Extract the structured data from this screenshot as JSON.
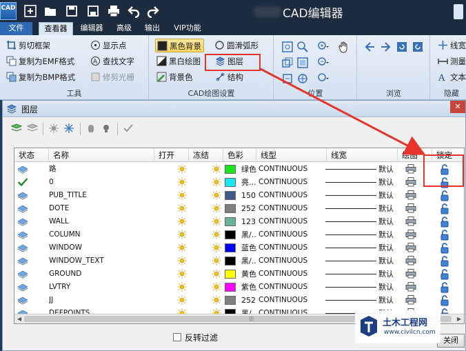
{
  "app": {
    "logo_text": "CAD",
    "title": "CAD编辑器"
  },
  "ribbon_tabs": [
    {
      "label": "文件"
    },
    {
      "label": "查看器"
    },
    {
      "label": "编辑器"
    },
    {
      "label": "高级"
    },
    {
      "label": "输出"
    },
    {
      "label": "VIP功能"
    }
  ],
  "ribbon": {
    "tools_group": {
      "label": "工具",
      "buttons": [
        "剪切框架",
        "复制为EMF格式",
        "复制为BMP格式",
        "显示点",
        "查找文字",
        "修剪光栅"
      ]
    },
    "draw_group": {
      "label": "CAD绘图设置",
      "buttons": [
        "黑色背景",
        "黑白绘图",
        "背景色",
        "圆滑弧形",
        "图层",
        "结构"
      ]
    },
    "position_group": {
      "label": "位置"
    },
    "browse_group": {
      "label": "浏览"
    },
    "hide_group": {
      "label": "隐藏",
      "buttons": [
        "线宽",
        "测量",
        "文本"
      ]
    }
  },
  "dialog": {
    "title": "图层",
    "close_label": "关闭",
    "filter_label": "反转过滤",
    "columns": [
      "状态",
      "名称",
      "打开",
      "冻结",
      "色彩",
      "线型",
      "线宽",
      "绘图",
      "锁定"
    ],
    "rows": [
      {
        "name": "路",
        "current": false,
        "color": "#19e619",
        "color_name": "绿色",
        "linetype": "CONTINUOUS",
        "lineweight": "默认"
      },
      {
        "name": "0",
        "current": true,
        "color": "#19e6f0",
        "color_name": "亮...",
        "linetype": "CONTINUOUS",
        "lineweight": "默认"
      },
      {
        "name": "PUB_TITLE",
        "current": false,
        "color": "#3f5a8a",
        "color_name": "150",
        "linetype": "CONTINUOUS",
        "lineweight": "默认"
      },
      {
        "name": "DOTE",
        "current": false,
        "color": "#7f7f7f",
        "color_name": "252",
        "linetype": "CONTINUOUS",
        "lineweight": "默认"
      },
      {
        "name": "WALL",
        "current": false,
        "color": "#66b29a",
        "color_name": "123",
        "linetype": "CONTINUOUS",
        "lineweight": "默认"
      },
      {
        "name": "COLUMN",
        "current": false,
        "color": "#000000",
        "color_name": "黑/...",
        "linetype": "CONTINUOUS",
        "lineweight": "默认"
      },
      {
        "name": "WINDOW",
        "current": false,
        "color": "#0000ff",
        "color_name": "蓝色",
        "linetype": "CONTINUOUS",
        "lineweight": "默认"
      },
      {
        "name": "WINDOW_TEXT",
        "current": false,
        "color": "#000000",
        "color_name": "黑/...",
        "linetype": "CONTINUOUS",
        "lineweight": "默认"
      },
      {
        "name": "GROUND",
        "current": false,
        "color": "#ffff00",
        "color_name": "黄色",
        "linetype": "CONTINUOUS",
        "lineweight": "默认"
      },
      {
        "name": "LVTRY",
        "current": false,
        "color": "#ff00ff",
        "color_name": "紫色",
        "linetype": "CONTINUOUS",
        "lineweight": "默认"
      },
      {
        "name": "JJ",
        "current": false,
        "color": "#7f7f7f",
        "color_name": "252",
        "linetype": "CONTINUOUS",
        "lineweight": "默认"
      },
      {
        "name": "DEFPOINTS",
        "current": false,
        "color": "#000000",
        "color_name": "黑/...",
        "linetype": "CONTINUOUS",
        "lineweight": "默认"
      }
    ]
  },
  "watermark": {
    "title": "土木工程网",
    "url": "www.civilcn.com"
  },
  "colors": {
    "highlight": "#e8332a",
    "titlebar": "#1c2b3d",
    "ribbon_tab_file": "#2e6bb4"
  }
}
